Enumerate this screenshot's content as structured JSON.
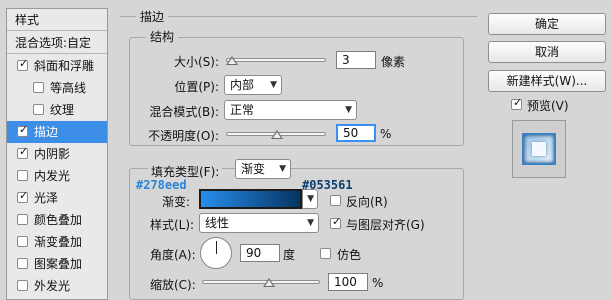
{
  "left_panel": {
    "header": "样式",
    "blend_options": "混合选项:自定",
    "items": [
      {
        "label": "斜面和浮雕",
        "checked": true,
        "indent": false,
        "selected": false
      },
      {
        "label": "等高线",
        "checked": false,
        "indent": true,
        "selected": false
      },
      {
        "label": "纹理",
        "checked": false,
        "indent": true,
        "selected": false
      },
      {
        "label": "描边",
        "checked": true,
        "indent": false,
        "selected": true
      },
      {
        "label": "内阴影",
        "checked": true,
        "indent": false,
        "selected": false
      },
      {
        "label": "内发光",
        "checked": false,
        "indent": false,
        "selected": false
      },
      {
        "label": "光泽",
        "checked": true,
        "indent": false,
        "selected": false
      },
      {
        "label": "颜色叠加",
        "checked": false,
        "indent": false,
        "selected": false
      },
      {
        "label": "渐变叠加",
        "checked": false,
        "indent": false,
        "selected": false
      },
      {
        "label": "图案叠加",
        "checked": false,
        "indent": false,
        "selected": false
      },
      {
        "label": "外发光",
        "checked": false,
        "indent": false,
        "selected": false
      }
    ]
  },
  "stroke": {
    "title": "描边",
    "structure": {
      "title": "结构",
      "size_label": "大小(S):",
      "size_value": "3",
      "size_unit": "像素",
      "position_label": "位置(P):",
      "position_value": "内部",
      "blend_label": "混合模式(B):",
      "blend_value": "正常",
      "opacity_label": "不透明度(O):",
      "opacity_value": "50",
      "opacity_unit": "%"
    },
    "fill": {
      "fill_type_label": "填充类型(F):",
      "fill_type_value": "渐变",
      "gradient_label": "渐变:",
      "color_start": "#278eed",
      "color_end": "#053561",
      "reverse_label": "反向(R)",
      "reverse_checked": false,
      "style_label": "样式(L):",
      "style_value": "线性",
      "align_label": "与图层对齐(G)",
      "align_checked": true,
      "angle_label": "角度(A):",
      "angle_value": "90",
      "angle_unit": "度",
      "dither_label": "仿色",
      "dither_checked": false,
      "scale_label": "缩放(C):",
      "scale_value": "100",
      "scale_unit": "%"
    }
  },
  "annotations": {
    "start": "#278eed",
    "end": "#053561"
  },
  "buttons": {
    "ok": "确定",
    "cancel": "取消",
    "new_style": "新建样式(W)...",
    "preview_label": "预览(V)",
    "preview_checked": true
  },
  "colors": {
    "selected": "#3d8ee6",
    "gradient_start": "#278eed",
    "gradient_end": "#053561",
    "annotation_start": "#2a86d8",
    "annotation_end": "#0d3e6d"
  }
}
